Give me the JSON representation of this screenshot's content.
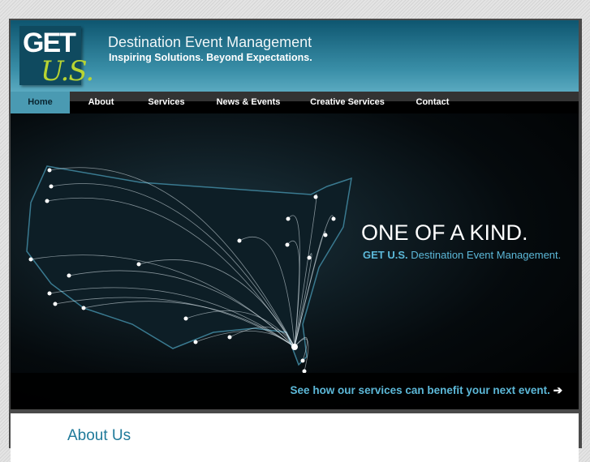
{
  "header": {
    "logo_top": "GET",
    "logo_bottom": "U.S.",
    "title": "Destination Event Management",
    "tagline": "Inspiring Solutions. Beyond Expectations."
  },
  "nav": {
    "items": [
      {
        "label": "Home",
        "active": true
      },
      {
        "label": "About"
      },
      {
        "label": "Services"
      },
      {
        "label": "News & Events"
      },
      {
        "label": "Creative Services"
      },
      {
        "label": "Contact"
      }
    ]
  },
  "hero": {
    "headline": "ONE OF A KIND.",
    "brand": "GET U.S.",
    "subline": "Destination Event Management.",
    "cta": "See how our services can benefit your next event.",
    "cta_arrow": "➔"
  },
  "content": {
    "heading": "About Us"
  },
  "colors": {
    "accent": "#5cb8d8",
    "logo_green": "#b8d432",
    "header": "#0e5670"
  }
}
